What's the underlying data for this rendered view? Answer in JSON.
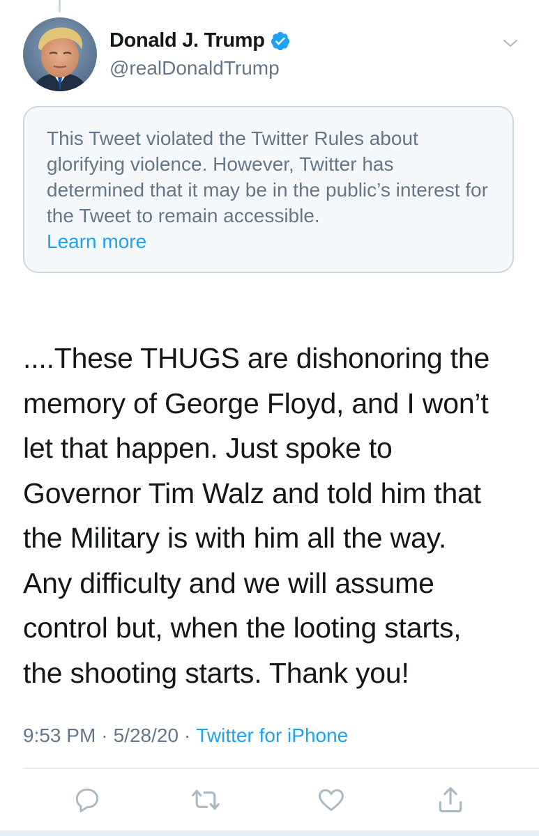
{
  "tweet": {
    "author": {
      "display_name": "Donald J. Trump",
      "handle": "@realDonaldTrump",
      "verified": true
    },
    "notice": {
      "text": "This Tweet violated the Twitter Rules about glorifying violence. However, Twitter has determined that it may be in the public’s interest for the Tweet to remain accessible.",
      "link_label": "Learn more"
    },
    "text_lines": [
      "....These THUGS are dishonoring the",
      "memory of George Floyd, and I won’t",
      "let that happen. Just spoke to",
      "Governor Tim Walz and told him that",
      "the Military is with him all the way.",
      "Any difficulty and we will assume",
      "control but, when the looting starts,",
      "the shooting starts. Thank you!"
    ],
    "meta": {
      "time": "9:53 PM",
      "separator": "·",
      "date": "5/28/20",
      "source": "Twitter for iPhone"
    },
    "actions": [
      {
        "name": "reply-icon"
      },
      {
        "name": "retweet-icon"
      },
      {
        "name": "like-icon"
      },
      {
        "name": "share-icon"
      }
    ]
  },
  "colors": {
    "text_primary": "#14171a",
    "text_secondary": "#657786",
    "link": "#1da1f2",
    "verified_badge": "#1da1f2",
    "notice_background": "#f5f8fa",
    "border": "#ccd6dd",
    "action_icon": "#aab8c2"
  }
}
